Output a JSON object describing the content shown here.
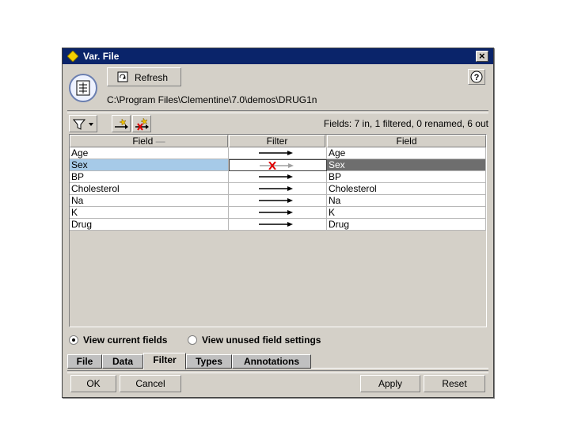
{
  "window": {
    "title": "Var. File"
  },
  "toolbar": {
    "refresh_label": "Refresh"
  },
  "file": {
    "path": "C:\\Program Files\\Clementine\\7.0\\demos\\DRUG1n"
  },
  "filter_bar": {
    "summary": "Fields:  7 in, 1 filtered, 0 renamed, 6 out"
  },
  "table": {
    "headers": [
      "Field",
      "Filter",
      "Field"
    ],
    "sort_indicator": "—",
    "rows": [
      {
        "in": "Age",
        "out": "Age",
        "filtered": false
      },
      {
        "in": "Sex",
        "out": "Sex",
        "filtered": true,
        "selected": true
      },
      {
        "in": "BP",
        "out": "BP",
        "filtered": false
      },
      {
        "in": "Cholesterol",
        "out": "Cholesterol",
        "filtered": false
      },
      {
        "in": "Na",
        "out": "Na",
        "filtered": false
      },
      {
        "in": "K",
        "out": "K",
        "filtered": false
      },
      {
        "in": "Drug",
        "out": "Drug",
        "filtered": false
      }
    ]
  },
  "view_options": [
    {
      "label": "View current fields",
      "selected": true
    },
    {
      "label": "View unused field settings",
      "selected": false
    }
  ],
  "tabs": [
    {
      "label": "File",
      "active": false
    },
    {
      "label": "Data",
      "active": false
    },
    {
      "label": "Filter",
      "active": true
    },
    {
      "label": "Types",
      "active": false
    },
    {
      "label": "Annotations",
      "active": false
    }
  ],
  "buttons": {
    "ok": "OK",
    "cancel": "Cancel",
    "apply": "Apply",
    "reset": "Reset"
  },
  "colors": {
    "title_bar": "#0a246a",
    "selected_field": "#a6cae8",
    "selected_output": "#6e6e6e",
    "filter_x": "#e00000"
  }
}
